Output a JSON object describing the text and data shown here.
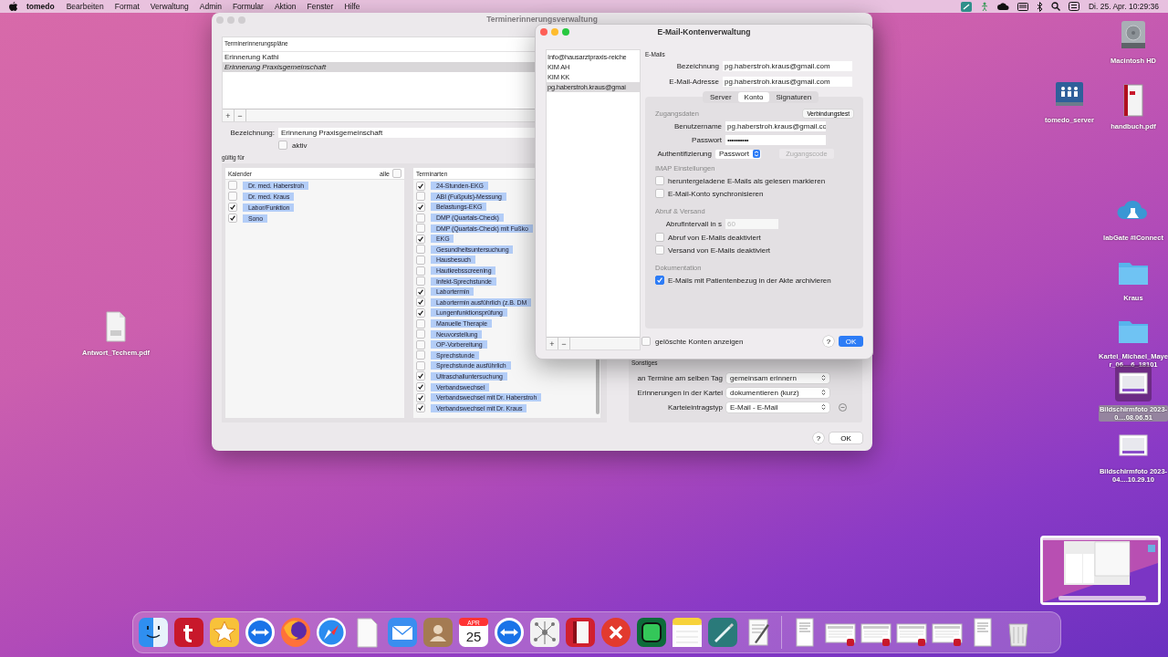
{
  "menubar": {
    "app": "tomedo",
    "menus": [
      "Bearbeiten",
      "Format",
      "Verwaltung",
      "Admin",
      "Formular",
      "Aktion",
      "Fenster",
      "Hilfe"
    ],
    "clock": "Di. 25. Apr. 10:29:36"
  },
  "reminder_window": {
    "title": "Terminerinnerungsverwaltung",
    "plans_header": "Terminerinnerungspläne",
    "plans": [
      {
        "label": "Erinnerung Kathi",
        "selected": false
      },
      {
        "label": "Erinnerung Praxisgemeinschaft",
        "selected": true
      }
    ],
    "add": "+",
    "remove": "−",
    "name_label": "Bezeichnung:",
    "name_value": "Erinnerung Praxisgemeinschaft",
    "active": {
      "label": "aktiv",
      "checked": false
    },
    "valid_for": "gültig für",
    "calendars_header": "Kalender",
    "all": {
      "label": "alle",
      "checked": false
    },
    "calendars": [
      {
        "label": "Dr. med. Haberstroh",
        "checked": false
      },
      {
        "label": "Dr. med. Kraus",
        "checked": false
      },
      {
        "label": "Labor/Funktion",
        "checked": true
      },
      {
        "label": "Sono",
        "checked": true
      }
    ],
    "types_header": "Terminarten",
    "types": [
      {
        "label": "24-Stunden-EKG",
        "checked": true
      },
      {
        "label": "ABI (Fußpuls)-Messung",
        "checked": false
      },
      {
        "label": "Belastungs-EKG",
        "checked": true
      },
      {
        "label": "DMP (Quartals-Check)",
        "checked": false
      },
      {
        "label": "DMP (Quartals-Check) mit Fußko",
        "checked": false
      },
      {
        "label": "EKG",
        "checked": true
      },
      {
        "label": "Gesundheitsuntersuchung",
        "checked": false
      },
      {
        "label": "Hausbesuch",
        "checked": false
      },
      {
        "label": "Hautkrebsscreening",
        "checked": false
      },
      {
        "label": "Infekt-Sprechstunde",
        "checked": false
      },
      {
        "label": "Labortermin",
        "checked": true
      },
      {
        "label": "Labortermin ausführlich (z.B. DM",
        "checked": true
      },
      {
        "label": "Lungenfunktionsprüfung",
        "checked": true
      },
      {
        "label": "Manuelle Therapie",
        "checked": false
      },
      {
        "label": "Neuvorstellung",
        "checked": false
      },
      {
        "label": "OP-Vorbereitung",
        "checked": false
      },
      {
        "label": "Sprechstunde",
        "checked": false
      },
      {
        "label": "Sprechstunde ausführlich",
        "checked": false
      },
      {
        "label": "Ultraschalluntersuchung",
        "checked": true
      },
      {
        "label": "Verbandswechsel",
        "checked": true
      },
      {
        "label": "Verbandswechsel mit Dr. Haberstroh",
        "checked": true
      },
      {
        "label": "Verbandswechsel mit Dr. Kraus",
        "checked": true
      }
    ],
    "other_heading": "Sonstiges",
    "other": [
      {
        "label": "an Termine am selben Tag",
        "value": "gemeinsam erinnern"
      },
      {
        "label": "Erinnerungen in der Kartei",
        "value": "dokumentieren (kurz)"
      },
      {
        "label": "Karteieintragstyp",
        "value": "E-Mail - E-Mail"
      }
    ],
    "help": "?",
    "ok": "OK"
  },
  "email_window": {
    "title": "E-Mail-Kontenverwaltung",
    "accounts": [
      {
        "label": "Info@hausarztpraxis-reiche",
        "selected": false
      },
      {
        "label": "KIM AH",
        "selected": false
      },
      {
        "label": "KIM KK",
        "selected": false
      },
      {
        "label": "pg.haberstroh.kraus@gmai",
        "selected": true
      }
    ],
    "add": "+",
    "remove": "−",
    "section": "E-Mails",
    "fields": [
      {
        "label": "Bezeichnung",
        "value": "pg.haberstroh.kraus@gmail.com"
      },
      {
        "label": "E-Mail-Adresse",
        "value": "pg.haberstroh.kraus@gmail.com"
      }
    ],
    "tabs": [
      {
        "label": "Server",
        "selected": false
      },
      {
        "label": "Konto",
        "selected": true
      },
      {
        "label": "Signaturen",
        "selected": false
      }
    ],
    "access": {
      "heading": "Zugangsdaten",
      "test_button": "Verbindungstest",
      "username_label": "Benutzername",
      "username": "pg.haberstroh.kraus@gmail.co",
      "password_label": "Passwort",
      "password": "••••••••••",
      "auth_label": "Authentifizierung",
      "auth_value": "Passwort",
      "code_button": "Zugangscode",
      "code_disabled": true
    },
    "imap": {
      "heading": "IMAP Einstellungen",
      "options": [
        {
          "label": "heruntergeladene E-Mails als gelesen markieren",
          "checked": false
        },
        {
          "label": "E-Mail-Konto synchronisieren",
          "checked": false
        }
      ]
    },
    "fetch": {
      "heading": "Abruf & Versand",
      "interval_label": "Abrufintervall in s",
      "interval_placeholder": "60",
      "options": [
        {
          "label": "Abruf von E-Mails deaktiviert",
          "checked": false
        },
        {
          "label": "Versand von E-Mails deaktiviert",
          "checked": false
        }
      ]
    },
    "docs": {
      "heading": "Dokumentation",
      "options": [
        {
          "label": "E-Mails mit Patientenbezug in der Akte archivieren",
          "checked": true
        }
      ]
    },
    "show_deleted": {
      "label": "gelöschte Konten anzeigen",
      "checked": false
    },
    "help": "?",
    "ok": "OK"
  },
  "desktop_icons": [
    {
      "label": "Antwort_Techem.pdf",
      "kind": "pdf",
      "selected": false
    },
    {
      "label": "Macintosh HD",
      "kind": "disk",
      "selected": false
    },
    {
      "label": "tomedo_server",
      "kind": "server",
      "selected": false
    },
    {
      "label": "handbuch.pdf",
      "kind": "book",
      "selected": false
    },
    {
      "label": "labGate #iConnect",
      "kind": "cloud",
      "selected": false
    },
    {
      "label": "Kraus",
      "kind": "folder",
      "selected": false
    },
    {
      "label": "Kartei_Michael_Mayer_06....6_18101",
      "kind": "folder",
      "selected": false
    },
    {
      "label": "Bildschirmfoto 2023-0....08.06.51",
      "kind": "screenshot",
      "selected": true
    },
    {
      "label": "Bildschirmfoto 2023-04....10.29.10",
      "kind": "screenshot",
      "selected": false
    }
  ],
  "dock": [
    {
      "kind": "finder"
    },
    {
      "kind": "redapp"
    },
    {
      "kind": "star"
    },
    {
      "kind": "remote"
    },
    {
      "kind": "globe"
    },
    {
      "kind": "compass"
    },
    {
      "kind": "page"
    },
    {
      "kind": "mail"
    },
    {
      "kind": "contacts"
    },
    {
      "kind": "calendar",
      "month": "APR",
      "day": "25"
    },
    {
      "kind": "remote"
    },
    {
      "kind": "network"
    },
    {
      "kind": "book"
    },
    {
      "kind": "cross"
    },
    {
      "kind": "chat"
    },
    {
      "kind": "notes"
    },
    {
      "kind": "pen"
    },
    {
      "kind": "textedit"
    },
    {
      "kind": "doc"
    },
    {
      "kind": "thumb"
    },
    {
      "kind": "thumb"
    },
    {
      "kind": "thumb"
    },
    {
      "kind": "thumb"
    },
    {
      "kind": "doc"
    },
    {
      "kind": "trash"
    }
  ]
}
